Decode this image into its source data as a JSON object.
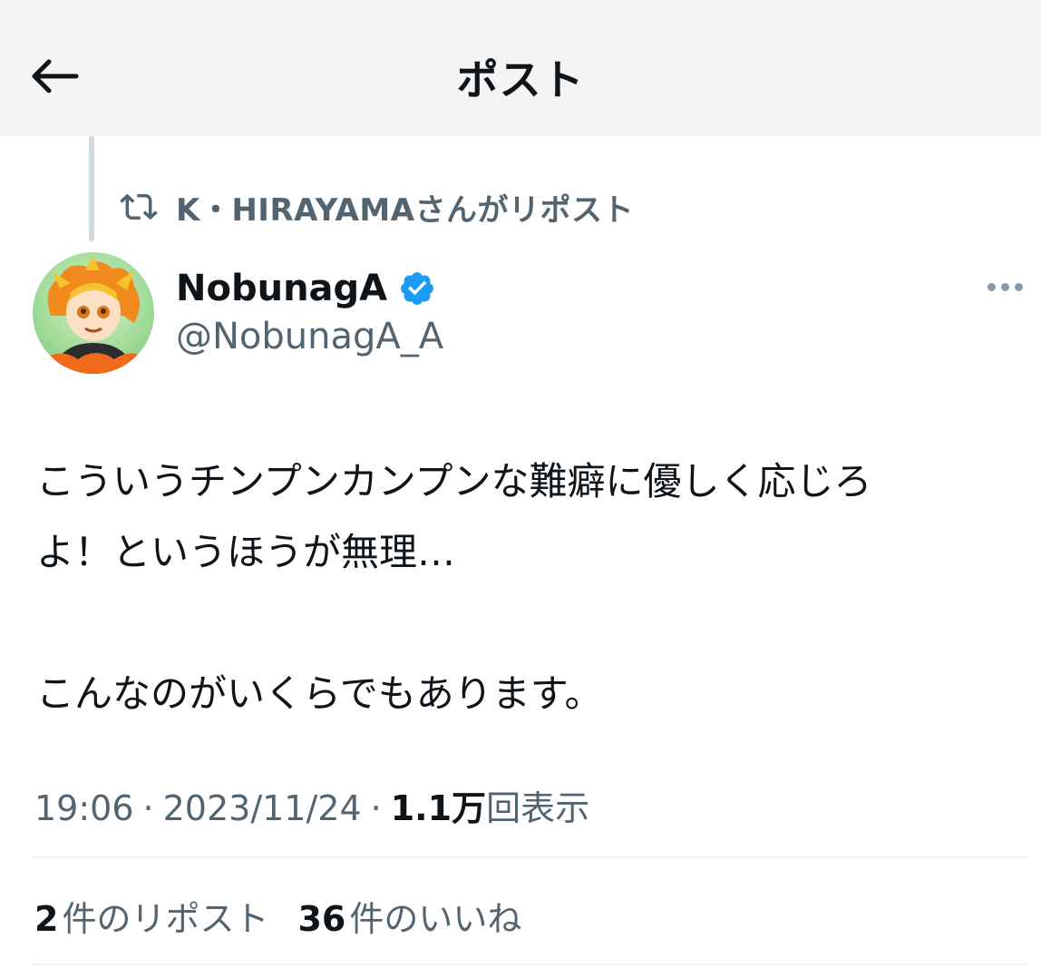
{
  "header": {
    "title": "ポスト",
    "back_icon": "arrow-left-icon"
  },
  "repost": {
    "icon": "repost-icon",
    "text": "K・HIRAYAMAさんがリポスト"
  },
  "author": {
    "name": "NobunagA",
    "handle": "@NobunagA_A",
    "verified": true,
    "verified_color": "#1d9bf0",
    "avatar_icon": "avatar"
  },
  "post": {
    "lines": [
      "こういうチンプンカンプンな難癖に優しく応じろ",
      "よ！というほうが無理…",
      "",
      "こんなのがいくらでもあります。"
    ]
  },
  "meta": {
    "time": "19:06",
    "date": "2023/11/24",
    "views_count": "1.1万",
    "views_label": "回表示"
  },
  "stats": {
    "reposts_count": "2",
    "reposts_label": "件のリポスト",
    "likes_count": "36",
    "likes_label": "件のいいね"
  },
  "colors": {
    "text_primary": "#0f1419",
    "text_secondary": "#536471",
    "header_bg": "#f4f4f5",
    "divider": "#eff3f4",
    "accent": "#1d9bf0"
  }
}
